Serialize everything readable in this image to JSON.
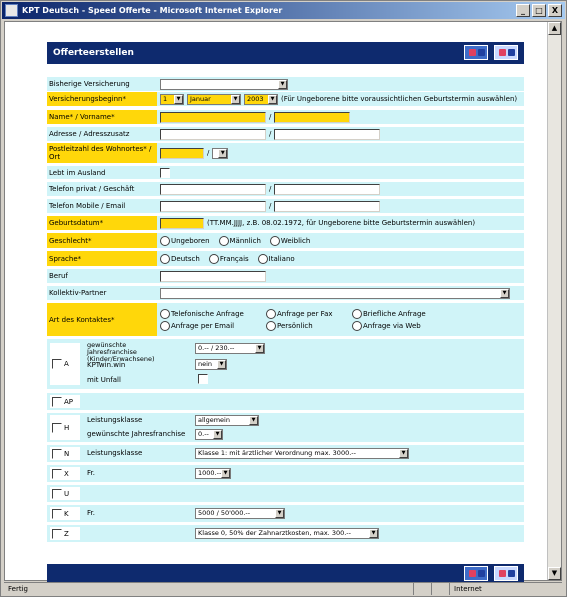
{
  "window": {
    "title": "KPT Deutsch - Speed Offerte - Microsoft Internet Explorer",
    "minimize": "_",
    "maximize": "□",
    "close": "X"
  },
  "header": {
    "title": "Offerteerstellen"
  },
  "fields": {
    "bisherige": "Bisherige Versicherung",
    "beginn": "Versicherungsbeginn*",
    "beginn_day": "1",
    "beginn_month": "Januar",
    "beginn_year": "2003",
    "beginn_hint": "(Für Ungeborene bitte voraussichtlichen Geburtstermin auswählen)",
    "name": "Name* / Vorname*",
    "adresse": "Adresse / Adresszusatz",
    "plz": "Postleitzahl des Wohnortes* / Ort",
    "ausland": "Lebt im Ausland",
    "telefon": "Telefon privat / Geschäft",
    "mobile": "Telefon Mobile / Email",
    "geburtsdatum": "Geburtsdatum*",
    "geburtsdatum_hint": "(TT.MM.JJJJ, z.B. 08.02.1972, für Ungeborene bitte Geburtstermin auswählen)",
    "geschlecht": "Geschlecht*",
    "geschlecht_opts": [
      "Ungeboren",
      "Männlich",
      "Weiblich"
    ],
    "sprache": "Sprache*",
    "sprache_opts": [
      "Deutsch",
      "Français",
      "Italiano"
    ],
    "beruf": "Beruf",
    "kollektiv": "Kollektiv-Partner",
    "kontakt": "Art des Kontaktes*",
    "kontakt_opts": [
      "Telefonische Anfrage",
      "Anfrage per Fax",
      "Briefliche Anfrage",
      "Anfrage per Email",
      "Persönlich",
      "Anfrage via Web"
    ],
    "slash": "/"
  },
  "blocks": {
    "A": {
      "code": "A",
      "franchise_label": "gewünschte Jahresfranchise (Kinder/Erwachsene)",
      "franchise_value": "0.-- / 230.--",
      "kptwin_label": "KPTwin.win",
      "kptwin_value": "nein",
      "unfall_label": "mit Unfall"
    },
    "AP": {
      "code": "AP"
    },
    "H": {
      "code": "H",
      "leistung_label": "Leistungsklasse",
      "leistung_value": "allgemein",
      "franchise_label": "gewünschte Jahresfranchise",
      "franchise_value": "0.--"
    },
    "N": {
      "code": "N",
      "leistung_label": "Leistungsklasse",
      "leistung_value": "Klasse 1: mit ärztlicher Verordnung max. 3000.--"
    },
    "X": {
      "code": "X",
      "fr_label": "Fr.",
      "fr_value": "1000.--"
    },
    "U": {
      "code": "U"
    },
    "K": {
      "code": "K",
      "fr_label": "Fr.",
      "fr_value": "5000 / 50'000.--"
    },
    "Z": {
      "code": "Z",
      "value": "Klasse 0, 50% der Zahnarztkosten, max. 300.--"
    }
  },
  "status": {
    "left": "Fertig",
    "zone": "Internet"
  },
  "colors": {
    "accent": "#0e2a6e",
    "required": "#ffd70a",
    "row": "#d0f4f8"
  }
}
